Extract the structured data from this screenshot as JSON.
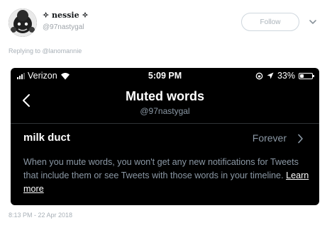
{
  "tweet": {
    "display_name": "✧ nessie ✧",
    "handle": "@97nastygal",
    "follow_label": "Follow",
    "replying_to": "Replying to @lanomannie",
    "timestamp": "8:13 PM - 22 Apr 2018"
  },
  "screenshot": {
    "status_bar": {
      "carrier": "Verizon",
      "time": "5:09 PM",
      "battery": "33%",
      "battery_level": 0.33
    },
    "nav": {
      "title": "Muted words",
      "subtitle": "@97nastygal"
    },
    "muted_item": {
      "word": "milk duct",
      "duration": "Forever"
    },
    "info_text": "When you mute words, you won't get any new notifications for Tweets that include them or see Tweets with those words in your timeline.",
    "learn_more": "Learn more"
  },
  "icons": {
    "avatar": "avatar-image",
    "caret": "chevron-down-icon",
    "wifi": "wifi-icon",
    "location": "location-arrow-icon",
    "lock": "rotation-lock-icon",
    "back": "chevron-left-icon",
    "row": "chevron-right-icon"
  }
}
